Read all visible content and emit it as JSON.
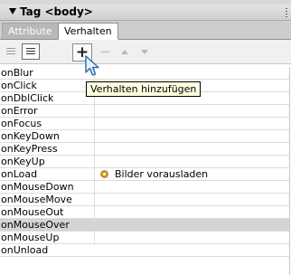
{
  "panel": {
    "title": "Tag <body>"
  },
  "tabs": [
    {
      "label": "Attribute",
      "active": false
    },
    {
      "label": "Verhalten",
      "active": true
    }
  ],
  "toolbar": {
    "add_label": "+",
    "remove_label": "−",
    "tooltip": "Verhalten hinzufügen"
  },
  "events": [
    {
      "event": "onBlur",
      "action": ""
    },
    {
      "event": "onClick",
      "action": ""
    },
    {
      "event": "onDblClick",
      "action": ""
    },
    {
      "event": "onError",
      "action": ""
    },
    {
      "event": "onFocus",
      "action": ""
    },
    {
      "event": "onKeyDown",
      "action": ""
    },
    {
      "event": "onKeyPress",
      "action": ""
    },
    {
      "event": "onKeyUp",
      "action": ""
    },
    {
      "event": "onLoad",
      "action": "Bilder vorausladen",
      "icon": "gear-icon"
    },
    {
      "event": "onMouseDown",
      "action": ""
    },
    {
      "event": "onMouseMove",
      "action": ""
    },
    {
      "event": "onMouseOut",
      "action": ""
    },
    {
      "event": "onMouseOver",
      "action": "",
      "selected": true
    },
    {
      "event": "onMouseUp",
      "action": ""
    },
    {
      "event": "onUnload",
      "action": ""
    }
  ],
  "colors": {
    "selected_row": "#d4d4d4",
    "tooltip_bg": "#ffffe1",
    "panel_header": "#cfcfcf"
  }
}
